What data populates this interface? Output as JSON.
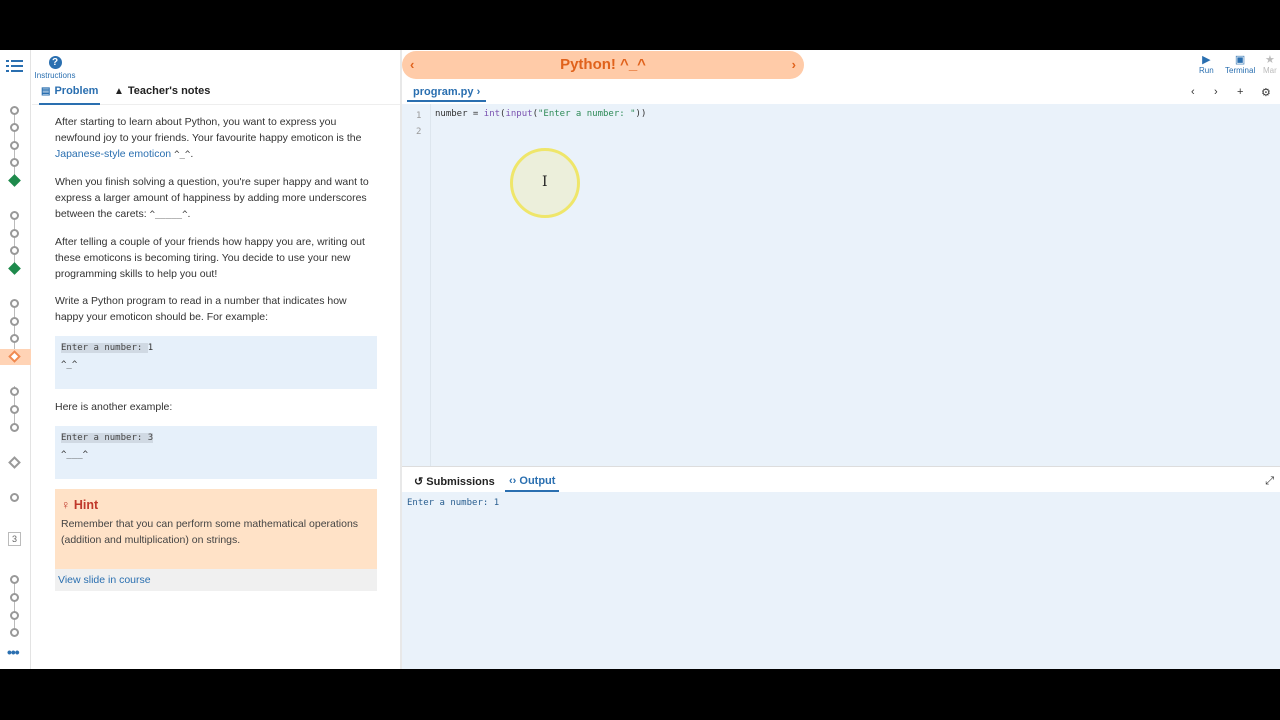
{
  "header": {
    "instructions_label": "Instructions",
    "title": "Python! ^_^",
    "prev_icon": "‹",
    "next_icon": "›"
  },
  "toolbar": {
    "run_label": "Run",
    "terminal_label": "Terminal",
    "more_label": "Mar"
  },
  "left_tabs": {
    "problem_label": "Problem",
    "notes_label": "Teacher's notes"
  },
  "problem": {
    "p1_pre": "After starting to learn about Python, you want to express you newfound joy to your friends. Your favourite happy emoticon is the ",
    "p1_link": "Japanese-style emoticon",
    "p1_code": "^_^",
    "p1_post": ".",
    "p2_pre": "When you finish solving a question, you're super happy and want to express a larger amount of happiness by adding more underscores between the carets: ",
    "p2_code": "^_____^",
    "p2_post": ".",
    "p3": "After telling a couple of your friends how happy you are, writing out these emoticons is becoming tiring. You decide to use your new programming skills to help you out!",
    "p4": "Write a Python program to read in a number that indicates how happy your emoticon should be. For example:",
    "ex1_prompt": "Enter a number: ",
    "ex1_value": "1",
    "ex1_out": "^_^",
    "p5": "Here is another example:",
    "ex2_prompt": "Enter a number: ",
    "ex2_value": "3",
    "ex2_out": "^___^",
    "hint_title": "Hint",
    "hint_body": "Remember that you can perform some mathematical operations (addition and multiplication) on strings.",
    "slide_link": "View slide in course"
  },
  "editor": {
    "file_tab": "program.py",
    "line_numbers": [
      "1",
      "2"
    ],
    "code_var": "number = ",
    "code_int": "int",
    "code_paren1": "(",
    "code_input": "input",
    "code_paren2": "(",
    "code_string": "\"Enter a number: \"",
    "code_end": "))"
  },
  "output_panel": {
    "submissions_label": "Submissions",
    "output_label": "Output",
    "output_text": "Enter a number: 1"
  },
  "rail": {
    "step_number": "3"
  },
  "colors": {
    "accent": "#2a6fb0",
    "title_bg": "#ffcba8",
    "title_fg": "#e0621c",
    "hint_bg": "#ffe2c7",
    "editor_bg": "#eaf2fa",
    "complete": "#1e8a4c"
  }
}
